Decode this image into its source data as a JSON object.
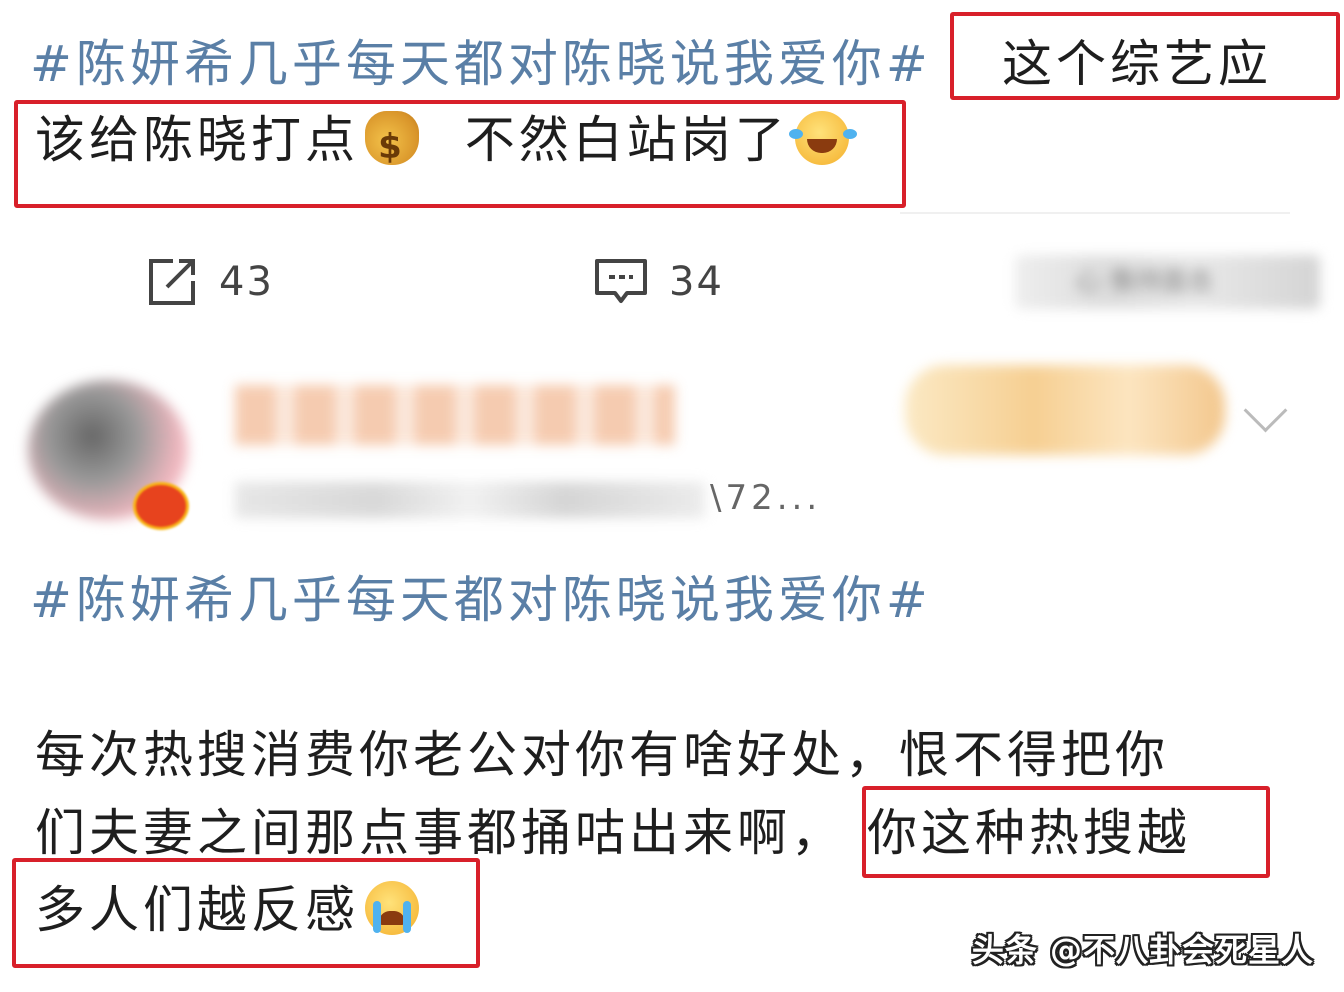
{
  "post1": {
    "topic": "#陈妍希几乎每天都对陈晓说我爱你#",
    "text_part1": "这个综艺应",
    "text_part2_a": "该给陈晓打点",
    "text_part2_b": "不然白站岗了",
    "emoji1": "money-bag-icon",
    "emoji2": "laughing-crying-icon"
  },
  "actions": {
    "share_count": "43",
    "comment_count": "34",
    "like_blurred": "心 像持面击"
  },
  "user": {
    "id_fragment": "\\72..."
  },
  "post2": {
    "topic": "#陈妍希几乎每天都对陈晓说我爱你#",
    "line1": "每次热搜消费你老公对你有啥好处，恨不得把你",
    "line2_a": "们夫妻之间那点事都捅咕出来啊，",
    "line2_b": "你这种热搜越",
    "line3": "多人们越反感",
    "emoji": "crying-face-icon"
  },
  "watermark": "头条 @不八卦会死星人",
  "colors": {
    "topic": "#5a7fa6",
    "highlight_box": "#d8202a"
  }
}
